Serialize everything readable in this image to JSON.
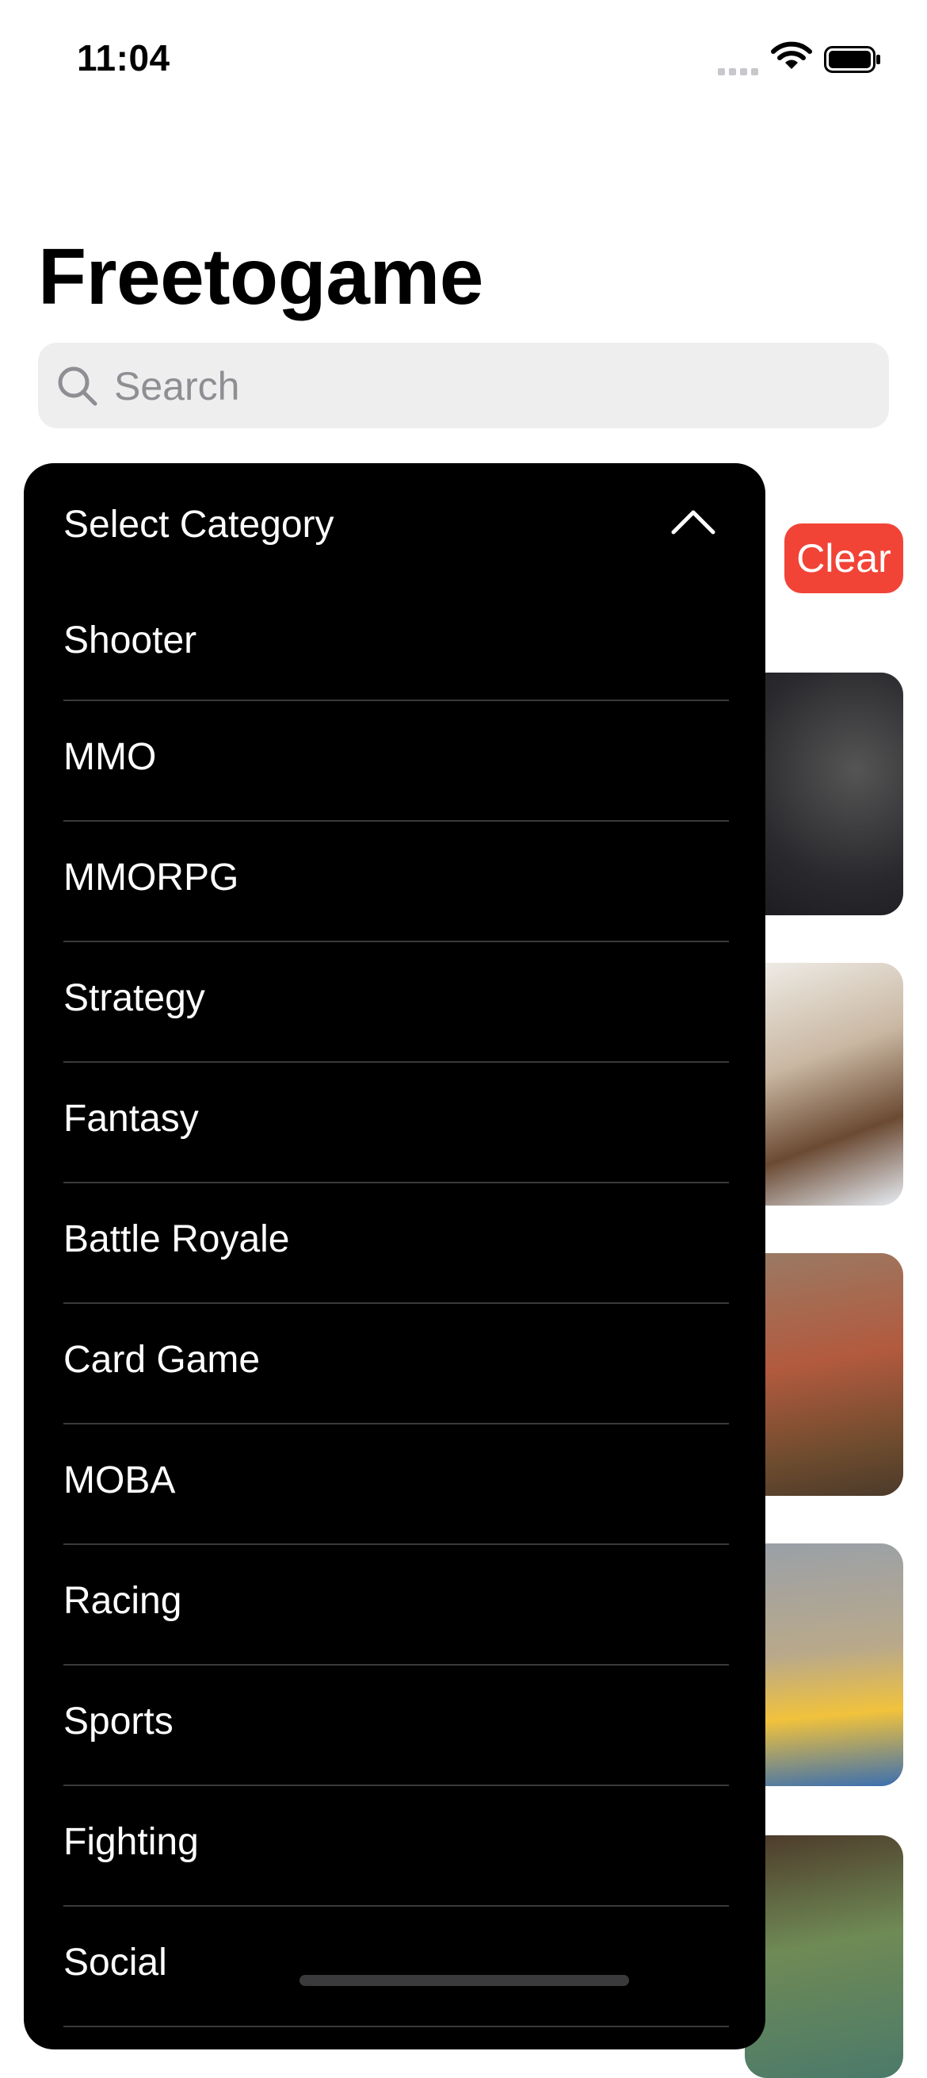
{
  "status_bar": {
    "time": "11:04"
  },
  "header": {
    "title": "Freetogame"
  },
  "search": {
    "placeholder": "Search",
    "value": ""
  },
  "filter": {
    "clear_label": "Clear"
  },
  "dropdown": {
    "title": "Select Category",
    "expanded": true,
    "options": [
      "Shooter",
      "MMO",
      "MMORPG",
      "Strategy",
      "Fantasy",
      "Battle Royale",
      "Card Game",
      "MOBA",
      "Racing",
      "Sports",
      "Fighting",
      "Social"
    ]
  },
  "colors": {
    "clear_button": "#f14437",
    "dropdown_background": "#000000",
    "search_background": "#eeeeef",
    "divider": "#3a3a3c"
  }
}
